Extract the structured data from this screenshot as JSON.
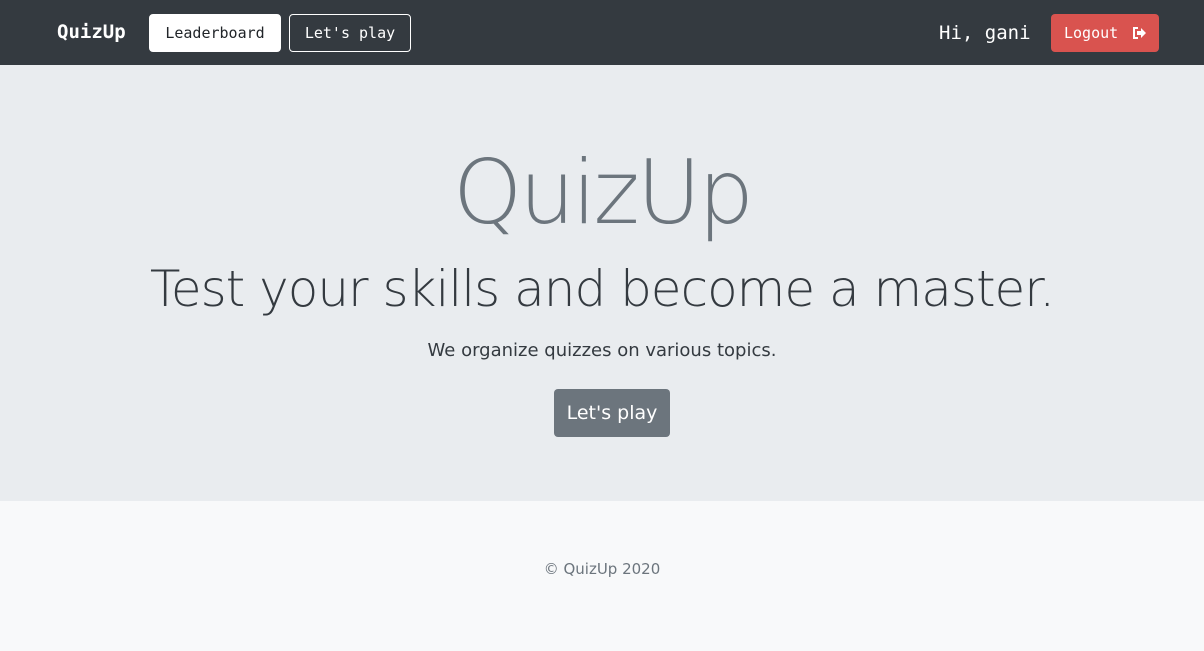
{
  "navbar": {
    "brand": "QuizUp",
    "leaderboard_label": "Leaderboard",
    "play_label": "Let's play",
    "greeting": "Hi, gani",
    "logout_label": "Logout",
    "logout_icon": "sign-out-icon"
  },
  "hero": {
    "title": "QuizUp",
    "subtitle": "Test your skills and become a master.",
    "lead": "We organize quizzes on various topics.",
    "cta_label": "Let's play"
  },
  "footer": {
    "copyright": "© QuizUp 2020"
  },
  "colors": {
    "navbar_bg": "#343a40",
    "jumbotron_bg": "#e9ecef",
    "footer_bg": "#f8f9fa",
    "danger": "#d9534f",
    "secondary": "#6c757d"
  }
}
